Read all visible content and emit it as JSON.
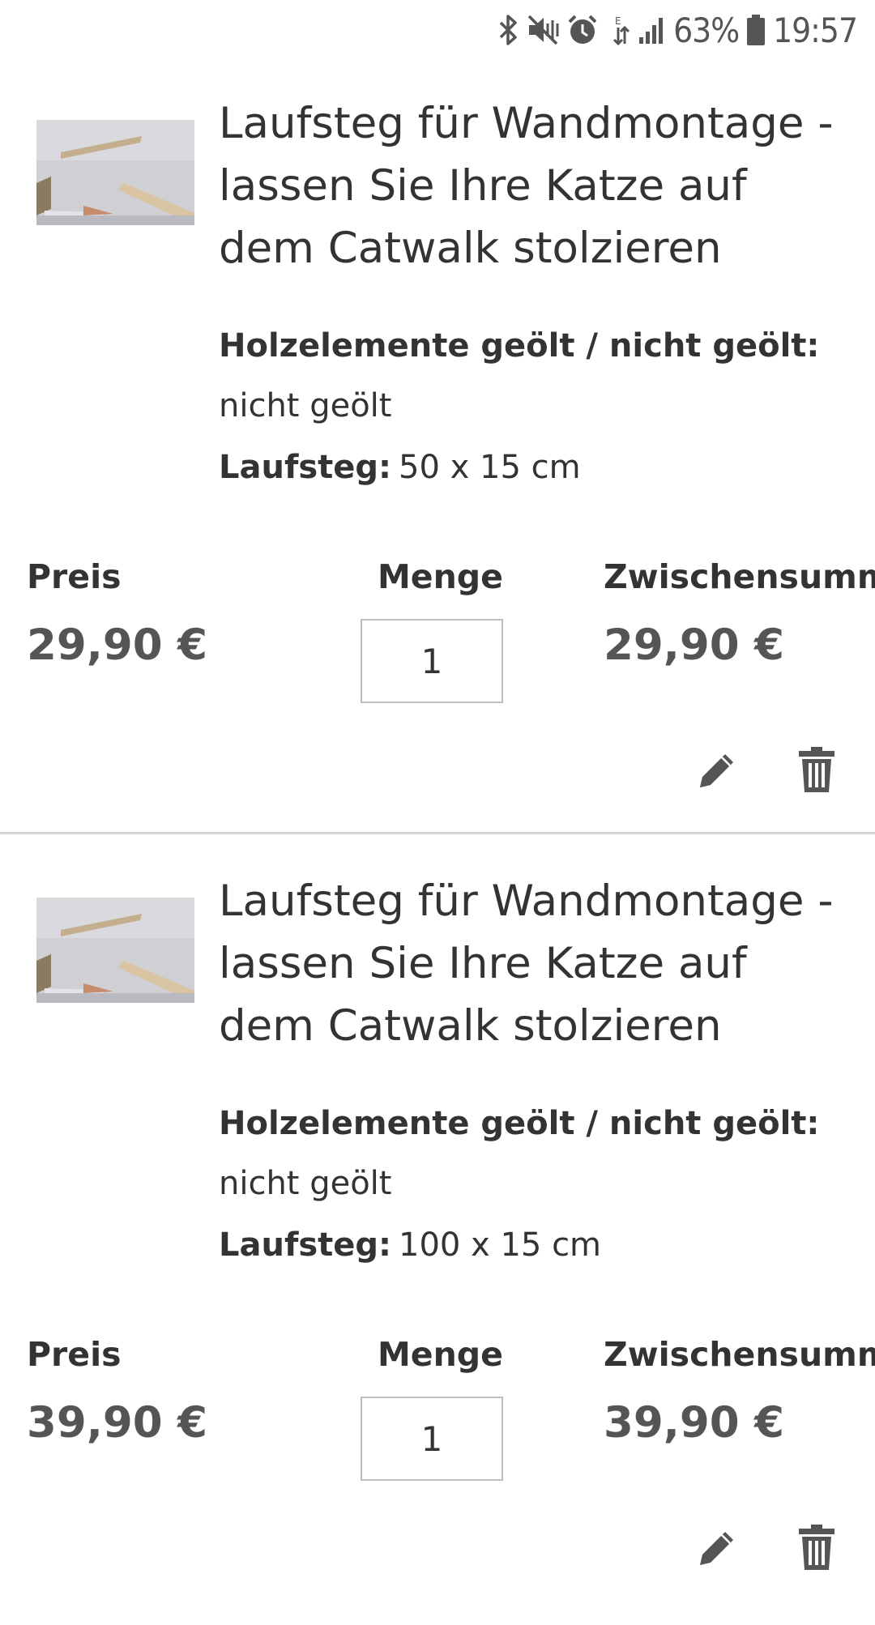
{
  "status_bar": {
    "icons": [
      "bluetooth-icon",
      "vibrate-mute-icon",
      "alarm-icon",
      "data-transfer-icon",
      "signal-icon",
      "battery-icon"
    ],
    "battery": "63%",
    "time": "19:57"
  },
  "colors": {
    "text": "#333333",
    "price": "#555555",
    "divider": "#d6d6d6",
    "input_border": "#bdbdbd"
  },
  "items": [
    {
      "title": "Laufsteg für Wandmontage - lassen Sie Ihre Katze auf dem Catwalk stolzieren",
      "option1_label": "Holzelemente geölt / nicht geölt:",
      "option1_value": "nicht geölt",
      "option2_label": "Laufsteg:",
      "option2_value": "50 x 15 cm",
      "price_label": "Preis",
      "price": "29,90 €",
      "qty_label": "Menge",
      "qty": "1",
      "subtotal_label": "Zwischensumme",
      "subtotal": "29,90 €",
      "actions": [
        "edit-pencil-icon",
        "delete-trash-icon"
      ]
    },
    {
      "title": "Laufsteg für Wandmontage - lassen Sie Ihre Katze auf dem Catwalk stolzieren",
      "option1_label": "Holzelemente geölt / nicht geölt:",
      "option1_value": "nicht geölt",
      "option2_label": "Laufsteg:",
      "option2_value": "100 x 15 cm",
      "price_label": "Preis",
      "price": "39,90 €",
      "qty_label": "Menge",
      "qty": "1",
      "subtotal_label": "Zwischensumme",
      "subtotal": "39,90 €",
      "actions": [
        "edit-pencil-icon",
        "delete-trash-icon"
      ]
    }
  ]
}
